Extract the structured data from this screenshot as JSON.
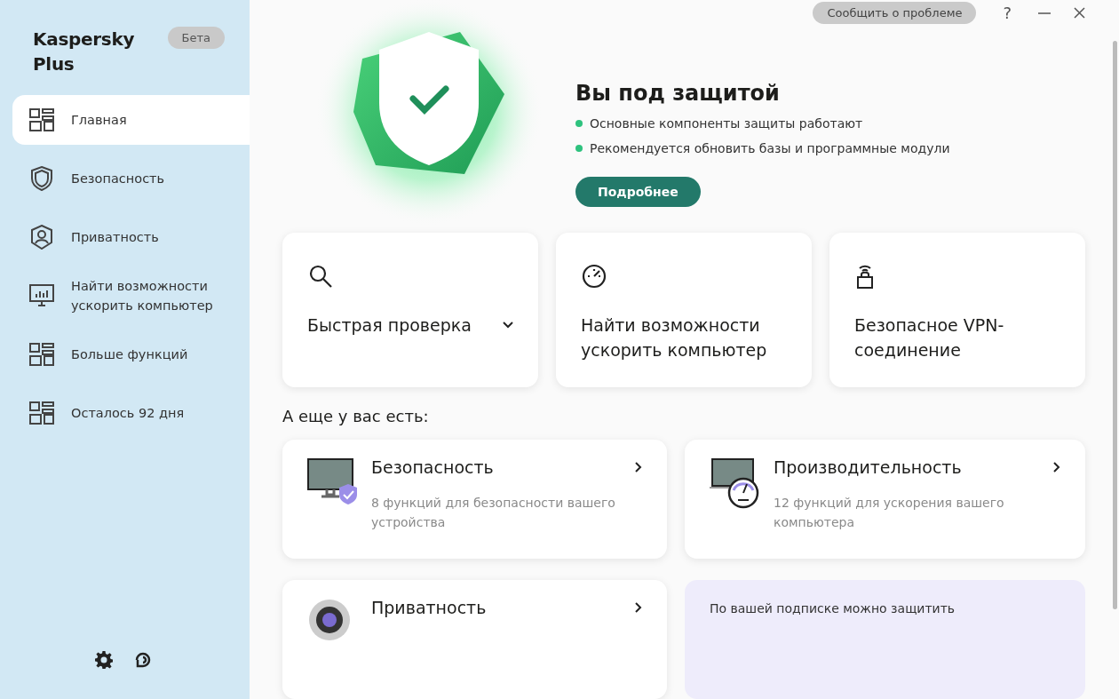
{
  "sidebar": {
    "title": "Kaspersky Plus",
    "badge": "Бета",
    "items": [
      {
        "label": "Главная",
        "kind": "grid",
        "selected": true
      },
      {
        "label": "Безопасность",
        "kind": "shield",
        "selected": false
      },
      {
        "label": "Приватность",
        "kind": "person",
        "selected": false
      },
      {
        "label": "Найти возможности ускорить компьютер",
        "kind": "monitor",
        "selected": false
      },
      {
        "label": "Больше функций",
        "kind": "grid",
        "selected": false
      },
      {
        "label": "Осталось 92 дня",
        "kind": "grid",
        "selected": false
      }
    ]
  },
  "topbar": {
    "report_button": "Сообщить о проблеме",
    "help": "?"
  },
  "status": {
    "title": "Вы под защитой",
    "points": [
      "Основные компоненты защиты работают",
      "Рекомендуется обновить базы и программные модули"
    ],
    "button": "Подробнее"
  },
  "tiles": [
    {
      "kind": "search",
      "label": "Быстрая проверка",
      "dropdown": true
    },
    {
      "kind": "gauge",
      "label": "Найти возможности ускорить компьютер",
      "dropdown": false
    },
    {
      "kind": "lock",
      "label": "Безопасное VPN-соединение",
      "dropdown": false
    }
  ],
  "more": {
    "heading": "А еще у вас есть:",
    "cards": [
      {
        "kind": "security",
        "title": "Безопасность",
        "description": "8 функций для безопасности вашего устройства"
      },
      {
        "kind": "performance",
        "title": "Производительность",
        "description": "12 функций для ускорения вашего компьютера"
      },
      {
        "kind": "privacy",
        "title": "Приватность"
      }
    ],
    "subscription_note": "По вашей подписке можно защитить"
  }
}
